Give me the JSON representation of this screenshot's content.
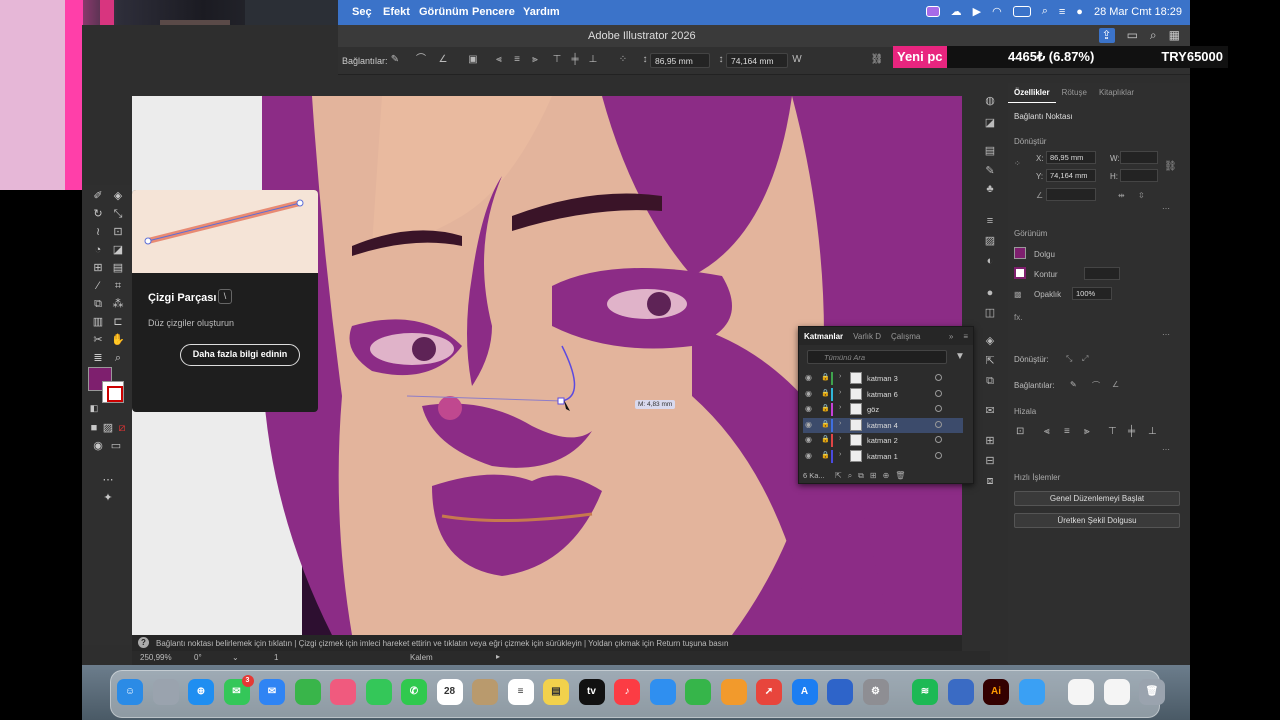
{
  "menubar": {
    "items": [
      "Seç",
      "Efekt",
      "Görünüm",
      "Pencere",
      "Yardım"
    ],
    "datetime": "28 Mar Cmt  18:29"
  },
  "window": {
    "title": "Adobe Illustrator 2026"
  },
  "controlbar": {
    "label": "Bağlantılar:",
    "x_value": "86,95 mm",
    "y_value": "74,164 mm",
    "w_label": "W"
  },
  "ticker": {
    "name": "Yeni pc",
    "change": "4465₺ (6.87%)",
    "price": "TRY65000"
  },
  "tooltip": {
    "title": "Çizgi Parçası",
    "shortcut": "\\",
    "description": "Düz çizgiler oluşturun",
    "button": "Daha fazla bilgi edinin"
  },
  "canvas": {
    "measure_label": "M: 4,83 mm"
  },
  "properties": {
    "tabs": [
      "Özellikler",
      "Rötuşe",
      "Kitaplıklar"
    ],
    "section_anchor": "Bağlantı Noktası",
    "transform_title": "Dönüştür",
    "x_label": "X:",
    "x_value": "86,95 mm",
    "y_label": "Y:",
    "y_value": "74,164 mm",
    "w_label": "W:",
    "h_label": "H:",
    "appearance_title": "Görünüm",
    "fill_label": "Dolgu",
    "stroke_label": "Kontur",
    "opacity_label": "Opaklık",
    "opacity_value": "100%",
    "fx_label": "fx.",
    "transform2_label": "Dönüştür:",
    "anchors_label": "Bağlantılar:",
    "align_title": "Hizala",
    "quick_actions_title": "Hızlı İşlemler",
    "quick_btn_1": "Genel Düzenlemeyi Başlat",
    "quick_btn_2": "Üretken Şekil Dolgusu",
    "fill_color": "#7e1f6e"
  },
  "layers": {
    "tabs": [
      "Katmanlar",
      "Varlık D",
      "Çalışma"
    ],
    "search_placeholder": "Tümünü Ara",
    "footer": "6 Ka...",
    "items": [
      {
        "name": "katman 3",
        "color": "#3fa34d"
      },
      {
        "name": "katman 6",
        "color": "#30b6d8"
      },
      {
        "name": "göz",
        "color": "#c740d8"
      },
      {
        "name": "katman 4",
        "color": "#3f6fe0"
      },
      {
        "name": "katman 2",
        "color": "#e04545"
      },
      {
        "name": "katman 1",
        "color": "#4a4ae0"
      }
    ],
    "selected_index": 3
  },
  "statusbar": {
    "text": "Bağlantı noktası belirlemek için tıklatın  |  Çizgi çizmek için imleci hareket ettirin ve tıklatın veya eğri çizmek için sürükleyin  |  Yoldan çıkmak için Return tuşuna basın"
  },
  "bottombar": {
    "zoom": "250,99%",
    "rotation": "0°",
    "artboard": "1",
    "tool_name": "Kalem"
  },
  "dock": {
    "calendar_day": "28",
    "messages_badge": "3",
    "icons": [
      "finder-icon",
      "launchpad-icon",
      "safari-icon",
      "messages-icon",
      "mail-icon",
      "maps-icon",
      "photos-icon",
      "facetime-icon",
      "phone-icon",
      "calendar-icon",
      "contacts-icon",
      "reminders-icon",
      "notes-icon",
      "tv-icon",
      "music-icon",
      "keynote-icon",
      "numbers-icon",
      "pages-icon",
      "rocket-icon",
      "appstore-icon",
      "preview-icon",
      "settings-icon",
      "spotify-icon",
      "finder2-icon",
      "illustrator-icon",
      "xcode-icon",
      "document-icon",
      "screenshot-icon",
      "trash-icon"
    ]
  }
}
